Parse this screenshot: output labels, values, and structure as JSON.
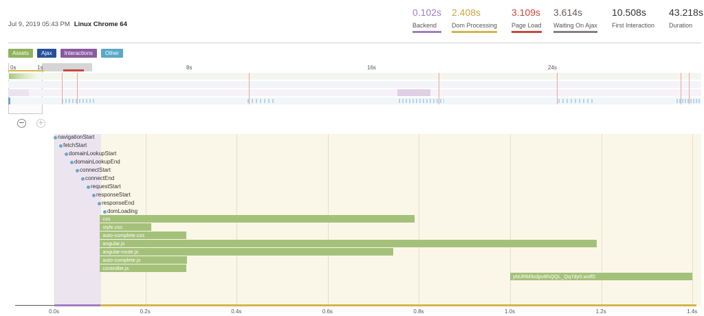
{
  "header": {
    "date": "Jul 9, 2019 05:43 PM",
    "agent": "Linux Chrome 64",
    "metrics": [
      {
        "value": "0.102s",
        "label": "Backend",
        "color": "#a07cc3",
        "bar": "#a07cc3"
      },
      {
        "value": "2.408s",
        "label": "Dom Processing",
        "color": "#c9a63f",
        "bar": "#d6b34c"
      },
      {
        "value": "3.109s",
        "label": "Page Load",
        "color": "#c8473c",
        "bar": "#c8473c"
      },
      {
        "value": "3.614s",
        "label": "Waiting On Ajax",
        "color": "#6b5e5e",
        "bar": "#8b7c7c"
      },
      {
        "value": "10.508s",
        "label": "First Interaction",
        "color": "#333333",
        "bar": ""
      },
      {
        "value": "43.218s",
        "label": "Duration",
        "color": "#333333",
        "bar": ""
      }
    ]
  },
  "legend": [
    {
      "label": "Assets",
      "color": "#8db35c"
    },
    {
      "label": "Ajax",
      "color": "#27509b"
    },
    {
      "label": "Interactions",
      "color": "#8a5a9f"
    },
    {
      "label": "Other",
      "color": "#5aa7c9"
    }
  ],
  "overview": {
    "ticks": [
      "0s",
      "1s",
      "8s",
      "16s",
      "24s"
    ]
  },
  "milestones": [
    "navigationStart",
    "fetchStart",
    "domainLookupStart",
    "domainLookupEnd",
    "connectStart",
    "connectEnd",
    "requestStart",
    "responseStart",
    "responseEnd",
    "domLoading"
  ],
  "assets": [
    {
      "name": "css",
      "start_s": 0.1,
      "end_s": 0.79
    },
    {
      "name": "style.css",
      "start_s": 0.1,
      "end_s": 0.213
    },
    {
      "name": "auto-complete.css",
      "start_s": 0.1,
      "end_s": 0.29
    },
    {
      "name": "angular.js",
      "start_s": 0.1,
      "end_s": 1.19
    },
    {
      "name": "angular-route.js",
      "start_s": 0.1,
      "end_s": 0.743
    },
    {
      "name": "auto-complete.js",
      "start_s": 0.1,
      "end_s": 0.291
    },
    {
      "name": "controller.js",
      "start_s": 0.1,
      "end_s": 0.29
    },
    {
      "name": "yMJRMIlzdpvBhQQL_Qq7dy0.woff2",
      "start_s": 1.0,
      "end_s": 1.4
    }
  ],
  "axis": {
    "ticks": [
      "0.0s",
      "0.2s",
      "0.4s",
      "0.6s",
      "0.8s",
      "1.0s",
      "1.2s",
      "1.4s"
    ]
  }
}
